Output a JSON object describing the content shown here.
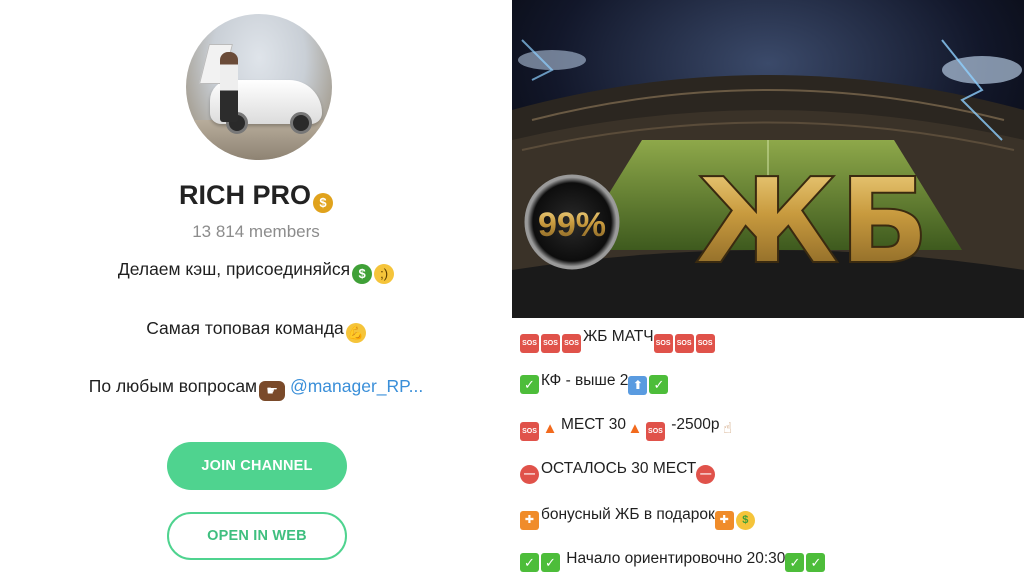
{
  "channel": {
    "name": "RICH PRO",
    "members": "13 814 members",
    "description": [
      "Делаем кэш, присоединяйся",
      "Самая топовая команда",
      "По любым вопросам"
    ],
    "mention": "@manager_RP...",
    "join_label": "JOIN CHANNEL",
    "open_web_label": "OPEN IN WEB"
  },
  "banner": {
    "badge": "99%",
    "headline": "ЖБ"
  },
  "post": {
    "line1": "ЖБ МАТЧ",
    "line2": "КФ - выше 2",
    "line3a": "МЕСТ 30",
    "line3b": " -2500р",
    "line4": "ОСТАЛОСЬ 30 МЕСТ",
    "line5": "бонусный ЖБ в подарок",
    "line6": " Начало ориентировочно 20:30"
  },
  "icons": {
    "sos_text": "SOS",
    "colors": {
      "accent_green": "#4fd38f",
      "mention_blue": "#3a8fd9",
      "sos_red": "#e0524a"
    }
  }
}
